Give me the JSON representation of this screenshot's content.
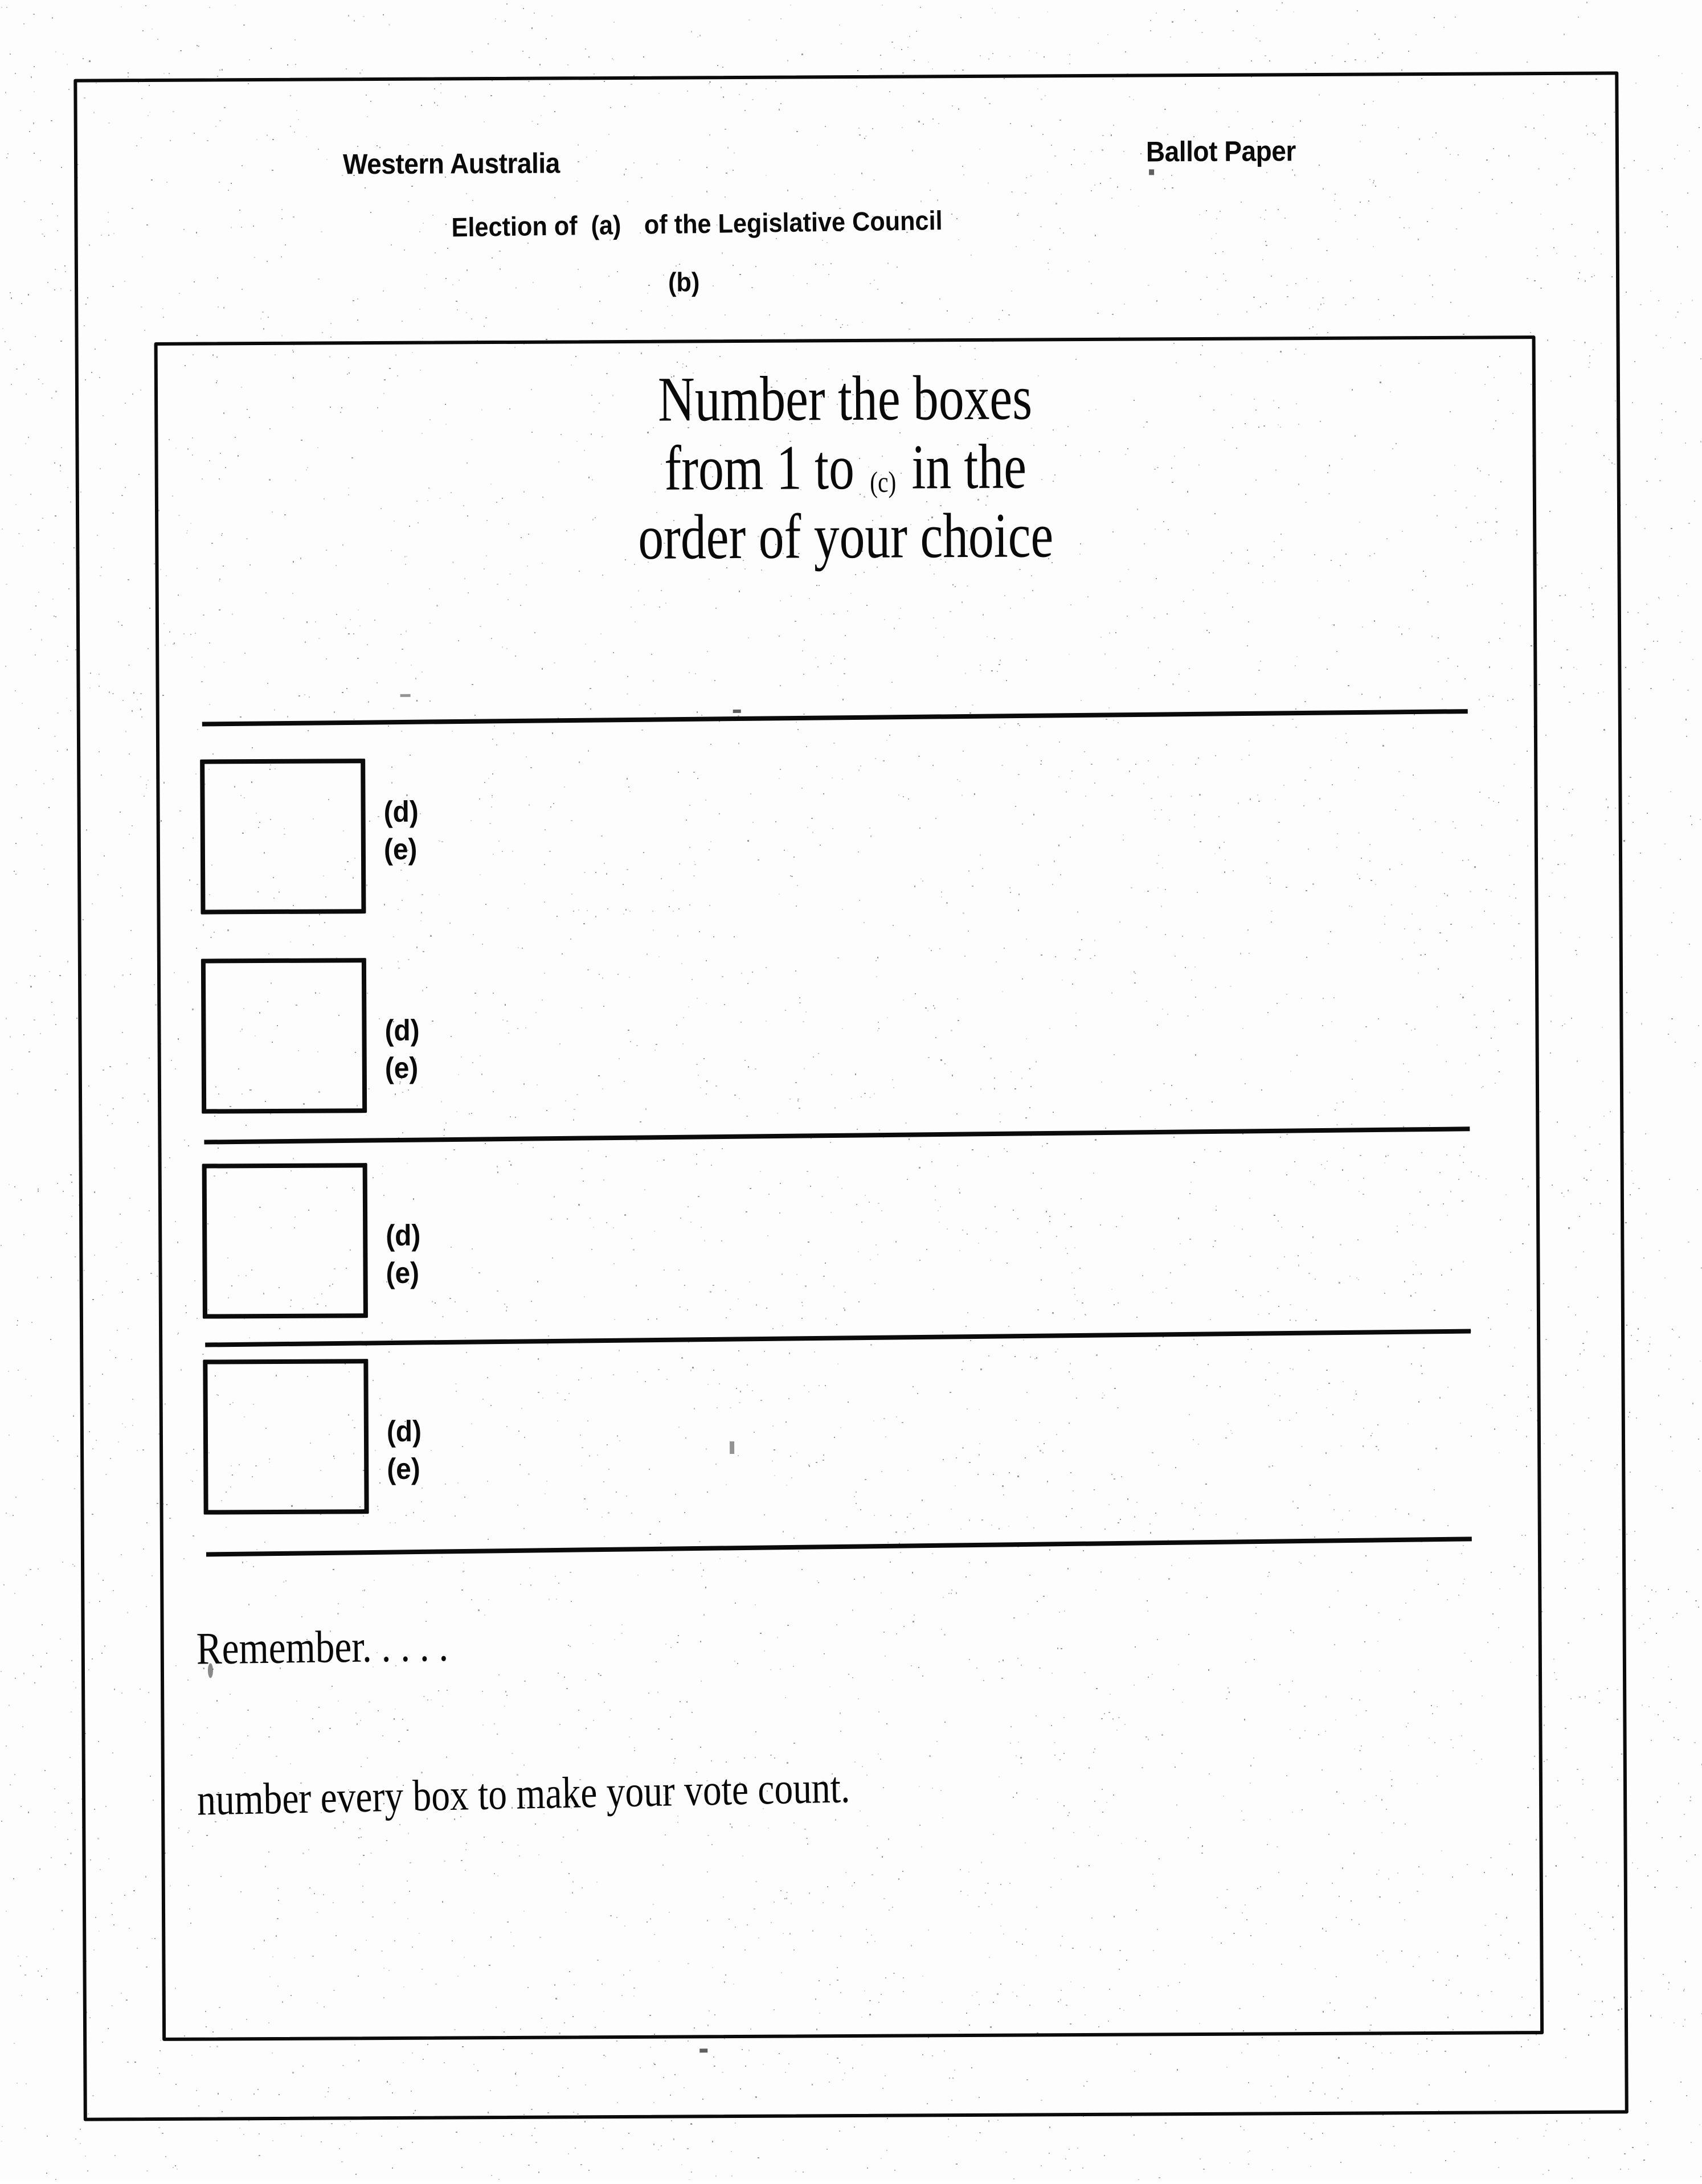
{
  "document": {
    "jurisdiction": "Western Australia",
    "document_type": "Ballot Paper",
    "election_line": {
      "prefix": "Election of",
      "placeholder_a": "(a)",
      "suffix": "of the Legislative Council"
    },
    "placeholder_b": "(b)"
  },
  "instruction": {
    "line1": "Number the boxes",
    "line2_before": "from 1 to",
    "line2_placeholder": "(c)",
    "line2_after": "in the",
    "line3": "order of your choice"
  },
  "candidate_rows": [
    {
      "box_value": "",
      "label_d": "(d)",
      "label_e": "(e)"
    },
    {
      "box_value": "",
      "label_d": "(d)",
      "label_e": "(e)"
    },
    {
      "box_value": "",
      "label_d": "(d)",
      "label_e": "(e)"
    },
    {
      "box_value": "",
      "label_d": "(d)",
      "label_e": "(e)"
    }
  ],
  "footer": {
    "remember": "Remember. . . . .",
    "instruction": "number every box to make your vote count."
  },
  "colors": {
    "ink": "#0b0b0b",
    "paper": "#fdfdfd"
  }
}
